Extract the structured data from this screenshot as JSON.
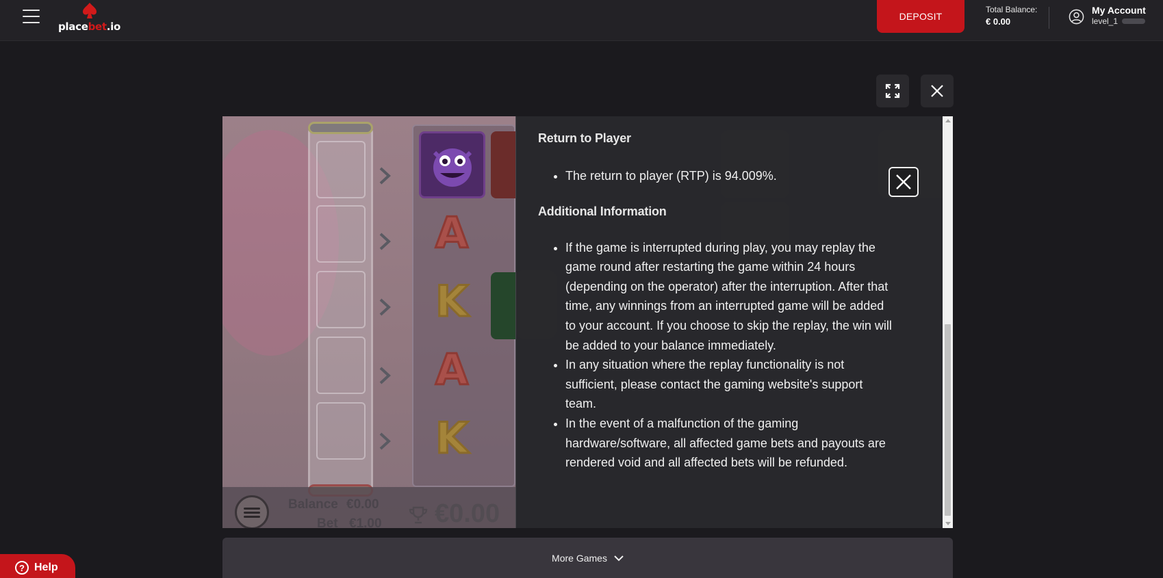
{
  "header": {
    "logo": {
      "part1": "place",
      "part2": "bet",
      "part3": ".io"
    },
    "deposit_label": "DEPOSIT",
    "balance_label": "Total Balance:",
    "balance_value": "€ 0.00",
    "account_title": "My Account",
    "account_level": "level_1"
  },
  "game": {
    "symbols": {
      "a": "A",
      "k": "K"
    },
    "balance_label": "Balance",
    "balance_value": "€0.00",
    "bet_label": "Bet",
    "bet_value": "€1.00",
    "win_value": "€0.00"
  },
  "info_panel": {
    "rtp_heading": "Return to Player",
    "rtp_items": [
      "The return to player (RTP) is 94.009%."
    ],
    "additional_heading": "Additional Information",
    "additional_items": [
      "If the game is interrupted during play, you may replay the game round after restarting the game within 24 hours (depending on the operator) after the interruption. After that time, any winnings from an interrupted game will be added to your account. If you choose to skip the replay, the win will be added to your balance immediately.",
      "In any situation where the replay functionality is not sufficient, please contact the gaming website's support team.",
      "In the event of a malfunction of the gaming hardware/software, all affected game bets and payouts are rendered void and all affected bets will be refunded."
    ]
  },
  "more_games_label": "More Games",
  "help_label": "Help",
  "icons": {
    "menu": "hamburger-icon",
    "logo": "spade-logo-icon",
    "account": "user-circle-icon",
    "expand": "fullscreen-icon",
    "close": "close-icon",
    "chevron": "chevron-down-icon",
    "help": "question-icon",
    "trophy": "trophy-icon"
  },
  "colors": {
    "brand_red": "#c4151b",
    "header_bg": "#232226",
    "page_bg": "#1b1a1e"
  }
}
